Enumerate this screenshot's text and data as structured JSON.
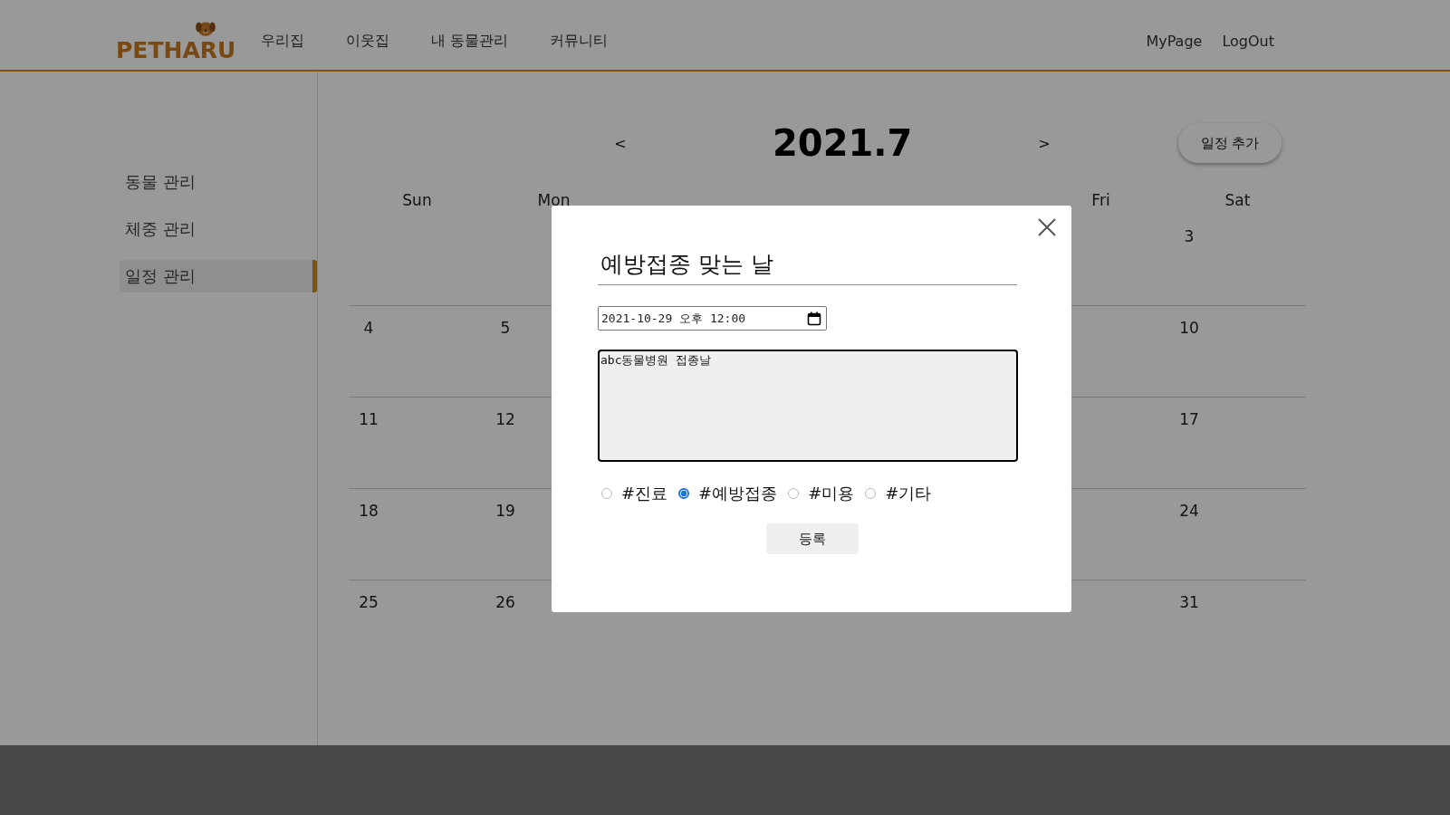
{
  "header": {
    "logo": "PETHARU",
    "nav": [
      "우리집",
      "이웃집",
      "내 동물관리",
      "커뮤니티"
    ],
    "user_links": [
      "MyPage",
      "LogOut"
    ]
  },
  "sidebar": {
    "items": [
      {
        "label": "동물 관리",
        "selected": false
      },
      {
        "label": "체중 관리",
        "selected": false
      },
      {
        "label": "일정 관리",
        "selected": true
      }
    ]
  },
  "calendar": {
    "prev": "<",
    "title": "2021.7",
    "next": ">",
    "add_button": "일정 추가",
    "weekdays": {
      "sun": "Sun",
      "mon": "Mon",
      "fri": "Fri",
      "sat": "Sat"
    },
    "weeks": [
      {
        "sat": "3"
      },
      {
        "sun": "4",
        "mon": "5",
        "sat": "10"
      },
      {
        "sun": "11",
        "mon": "12",
        "sat": "17"
      },
      {
        "sun": "18",
        "mon": "19",
        "sat": "24"
      },
      {
        "sun": "25",
        "mon": "26",
        "sat": "31"
      }
    ]
  },
  "modal": {
    "title_value": "예방접종 맞는 날",
    "datetime_value": "2021-10-29 오후 12:00",
    "memo_value": "abc동물병원 접종날",
    "categories": [
      {
        "label": "#진료",
        "selected": false
      },
      {
        "label": "#예방접종",
        "selected": true
      },
      {
        "label": "#미용",
        "selected": false
      },
      {
        "label": "#기타",
        "selected": false
      }
    ],
    "submit": "등록"
  }
}
